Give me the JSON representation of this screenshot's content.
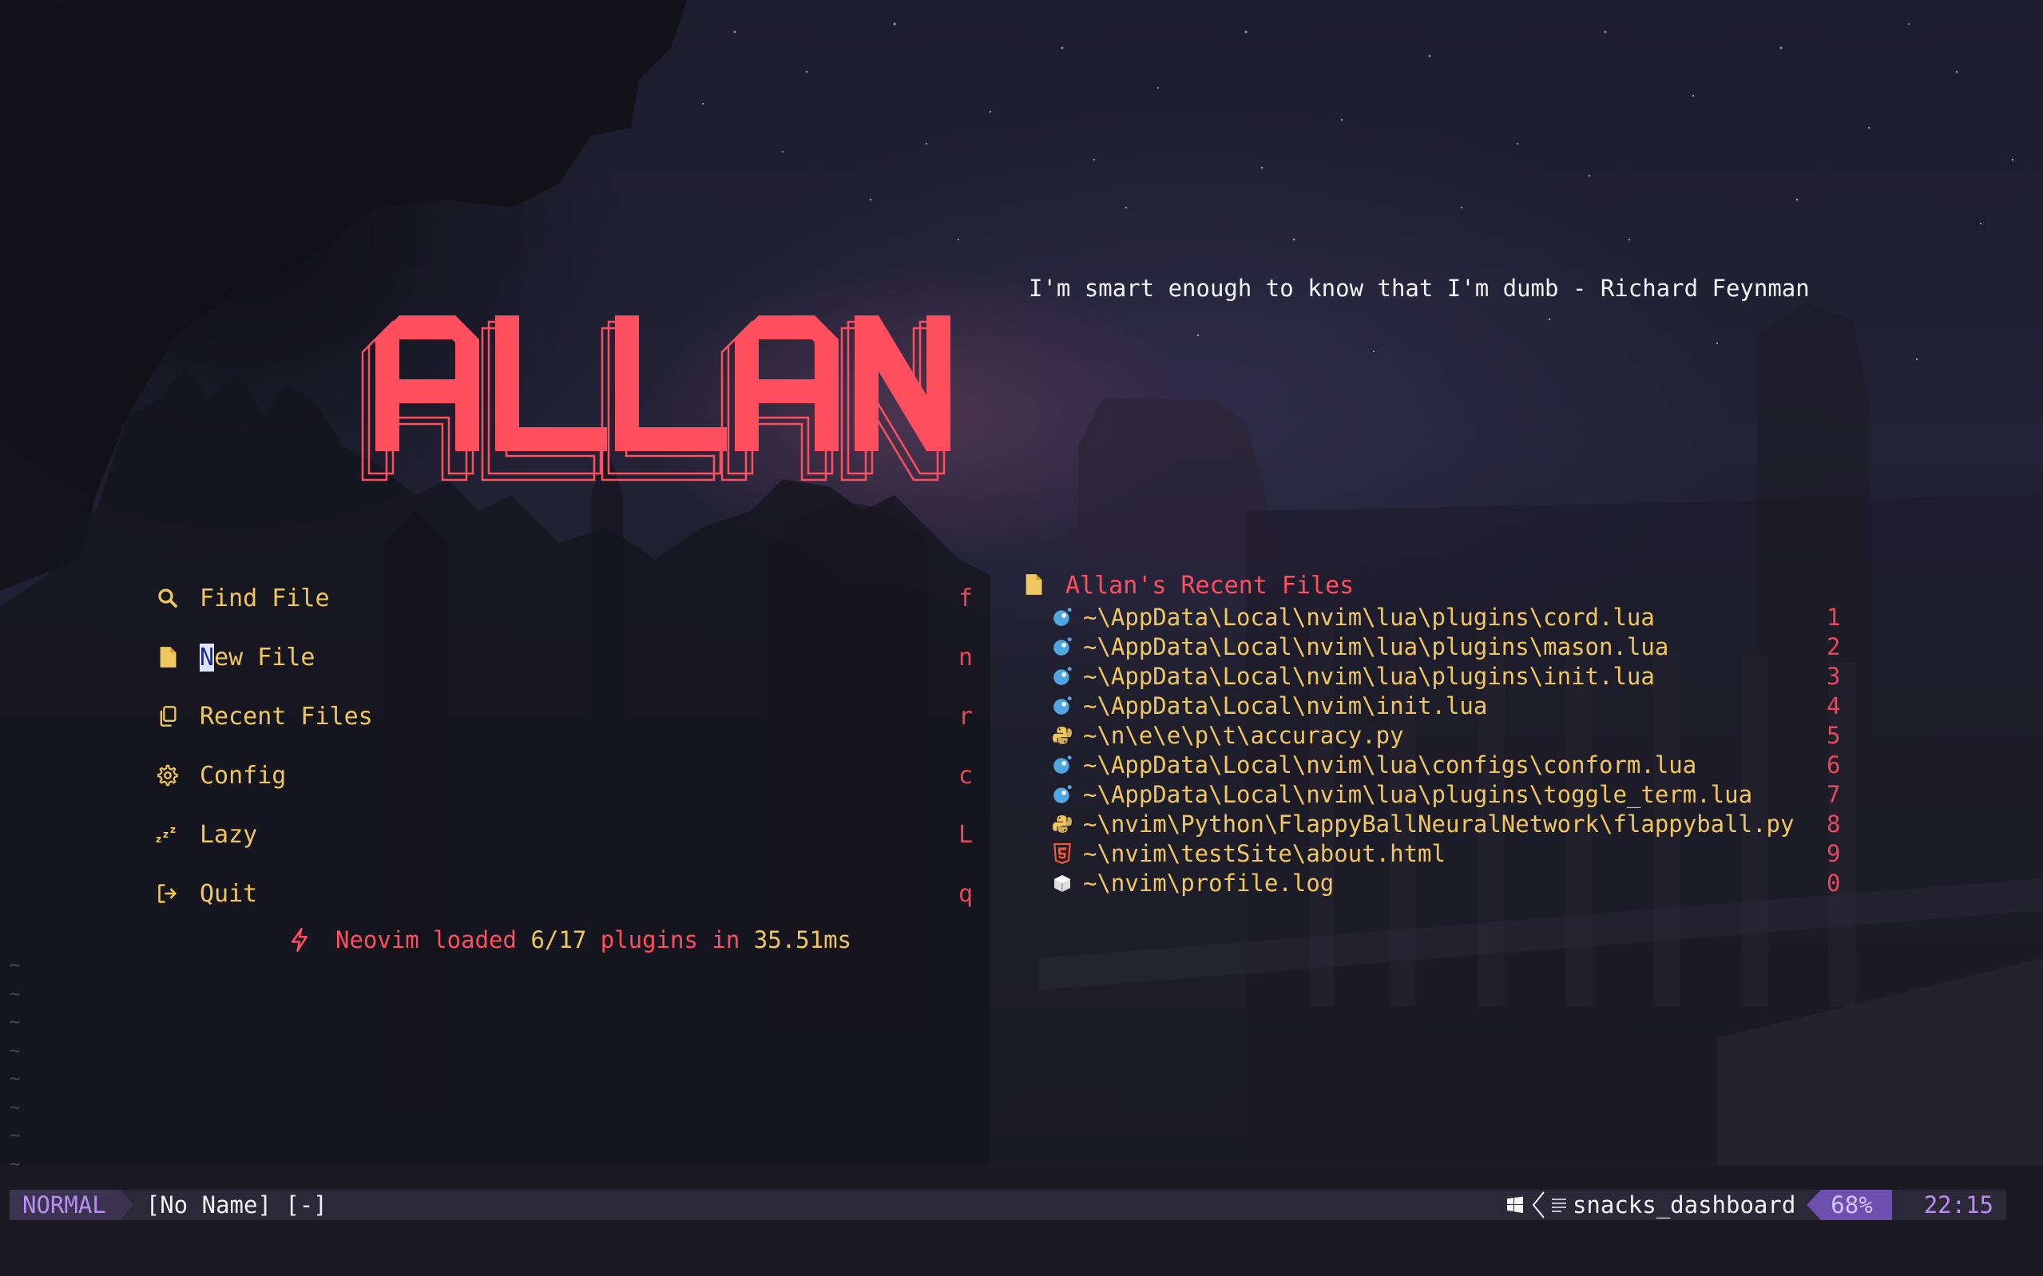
{
  "quote": "I'm smart enough to know that I'm dumb - Richard Feynman",
  "logo_text": "ALLAN",
  "colors": {
    "accent_red": "#ff4f5e",
    "accent_yellow": "#f0c75e",
    "mode_purple": "#b98cf2",
    "statusline_bg": "#2b2838"
  },
  "menu": [
    {
      "icon": "search-icon",
      "label": "Find File",
      "key": "f"
    },
    {
      "icon": "new-file-icon",
      "label_cursor": "N",
      "label_rest": "ew File",
      "key": "n"
    },
    {
      "icon": "copy-icon",
      "label": "Recent Files",
      "key": "r"
    },
    {
      "icon": "gear-icon",
      "label": "Config",
      "key": "c"
    },
    {
      "icon": "sleep-zzz-icon",
      "label": "Lazy",
      "key": "L"
    },
    {
      "icon": "exit-icon",
      "label": "Quit",
      "key": "q"
    }
  ],
  "startup": {
    "prefix": "Neovim loaded ",
    "loaded": "6/17",
    "middle": " plugins in ",
    "time": "35.51ms"
  },
  "recent_files": {
    "title": "Allan's Recent Files",
    "items": [
      {
        "icon": "lua-icon",
        "path": "~\\AppData\\Local\\nvim\\lua\\plugins\\cord.lua",
        "key": "1"
      },
      {
        "icon": "lua-icon",
        "path": "~\\AppData\\Local\\nvim\\lua\\plugins\\mason.lua",
        "key": "2"
      },
      {
        "icon": "lua-icon",
        "path": "~\\AppData\\Local\\nvim\\lua\\plugins\\init.lua",
        "key": "3"
      },
      {
        "icon": "lua-icon",
        "path": "~\\AppData\\Local\\nvim\\init.lua",
        "key": "4"
      },
      {
        "icon": "python-icon",
        "path": "~\\n\\e\\e\\p\\t\\accuracy.py",
        "key": "5"
      },
      {
        "icon": "lua-icon",
        "path": "~\\AppData\\Local\\nvim\\lua\\configs\\conform.lua",
        "key": "6"
      },
      {
        "icon": "lua-icon",
        "path": "~\\AppData\\Local\\nvim\\lua\\plugins\\toggle_term.lua",
        "key": "7"
      },
      {
        "icon": "python-icon",
        "path": "~\\nvim\\Python\\FlappyBallNeuralNetwork\\flappyball.py",
        "key": "8"
      },
      {
        "icon": "html5-icon",
        "path": "~\\nvim\\testSite\\about.html",
        "key": "9"
      },
      {
        "icon": "log-icon",
        "path": "~\\nvim\\profile.log",
        "key": "0"
      }
    ]
  },
  "tildes": [
    "~",
    "~",
    "~",
    "~",
    "~",
    "~",
    "~",
    "~"
  ],
  "statusline": {
    "mode": "NORMAL",
    "buffer": "[No Name] [-]",
    "filetype": "snacks_dashboard",
    "percent": "68%",
    "time": "22:15"
  }
}
